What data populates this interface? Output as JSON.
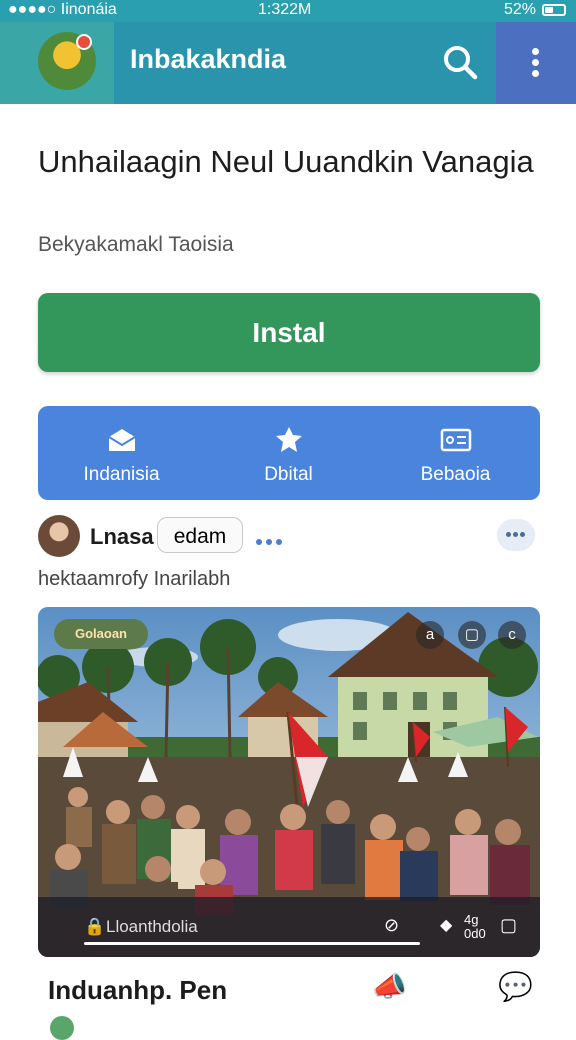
{
  "status_bar": {
    "carrier": "●●●●○ Iinonáia",
    "time": "1:322M",
    "battery": "52%"
  },
  "app_bar": {
    "title": "Inbakakndia",
    "search_icon": "search-icon",
    "menu_icon": "kebab-menu-icon",
    "accent": "#2a94ad"
  },
  "headline": "Unhailaagin Neul Uuandkin Vanagia",
  "subheading": "Bekyakamakl Taoisia",
  "install_button": {
    "label": "Instal",
    "color": "#33965b"
  },
  "actions": [
    {
      "label": "Indanisia",
      "icon": "mail-icon"
    },
    {
      "label": "Dbital",
      "icon": "star-badge-icon"
    },
    {
      "label": "Bebaoia",
      "icon": "id-card-icon"
    }
  ],
  "post": {
    "username": "Lnasa",
    "chip": "edam",
    "caption": "hektaamrofy Inarilabh"
  },
  "media": {
    "badge": "Golaoan",
    "top_icons": [
      "a",
      "▢",
      "c"
    ],
    "player_text": "Lloanthdolia",
    "player_count": "4g\n0d0"
  },
  "footer": {
    "title": "Induanhp. Pen"
  }
}
